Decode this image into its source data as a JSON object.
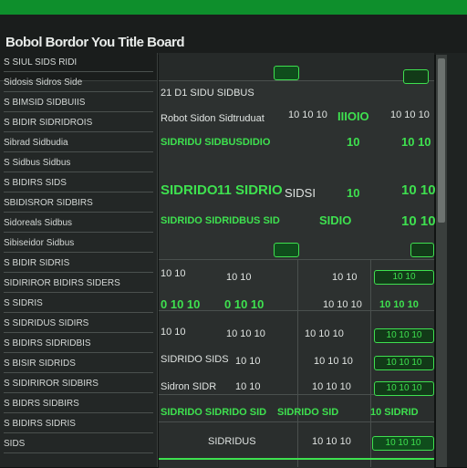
{
  "app": {
    "title": "Bobol Bordor You Title Board"
  },
  "sidebar": {
    "items": [
      {
        "label": "S SIUL SIDS RIDI"
      },
      {
        "label": "Sidosis Sidros Side"
      },
      {
        "label": "S BIMSID SIDBUIIS"
      },
      {
        "label": "S BIDIR SIDRIDROIS"
      },
      {
        "label": "Sibrad Sidbudia"
      },
      {
        "label": "S Sidbus Sidbus"
      },
      {
        "label": "S BIDIRS SIDS"
      },
      {
        "label": "SBIDISROR SIDBIRS"
      },
      {
        "label": "Sidoreals Sidbus"
      },
      {
        "label": "Sibiseidor Sidbus"
      },
      {
        "label": "S BIDIR SIDRIS"
      },
      {
        "label": "SIDIRIROR BIDIRS SIDERS"
      },
      {
        "label": "S SIDRIS"
      },
      {
        "label": "S SIDRIDUS SIDIRS"
      },
      {
        "label": "S BIDIRS SIDRIDBIS"
      },
      {
        "label": "S BISIR SIDRIDS"
      },
      {
        "label": "S SIDIRIROR SIDBIRS"
      },
      {
        "label": "S BIDRS SIDBIRS"
      },
      {
        "label": "S BIDIRS SIDRIS"
      },
      {
        "label": "SIDS"
      }
    ]
  },
  "header": {
    "col1": "21 D1 SIDU SIDBUS",
    "col2": "Robot Sidon Sidtruduat",
    "col3": "10 10 10",
    "col4": "IIIOIO",
    "col5": "10 10 10"
  },
  "grid": {
    "r1": [
      "SIDRIDU SIDBUSDIDIO",
      "10",
      "10 10"
    ],
    "r2": [
      "SIDRIDO",
      "11 SIDRIO",
      "SIDSI",
      "10",
      "10 10"
    ],
    "r3": [
      "SIDRIDO SIDRIDBUS SID",
      "SIDIO",
      "10 10"
    ],
    "r4": [
      "10 10",
      "10 10",
      "10 10",
      "10 10"
    ],
    "r5": [
      "0 10 10",
      "0 10 10",
      "10 10 10",
      "10 10 10"
    ],
    "r6": [
      "10 10",
      "10 10 10",
      "10 10 10",
      "10 10 10"
    ],
    "r7": [
      "SIDRIDO SIDS",
      "10 10",
      "10 10 10",
      "10 10 10"
    ],
    "r8": [
      "Sidron SIDR",
      "10 10",
      "10 10 10",
      "10 10 10"
    ],
    "r9": [
      "SIDRIDO SIDRIDO SID",
      "SIDRIDO SID",
      "10 SIDRID"
    ],
    "r10": [
      "SIDRIDUS",
      "10 10 10",
      "10 10 10"
    ]
  },
  "colors": {
    "accent": "#3ee04f",
    "topbar": "#0e8f2c"
  }
}
